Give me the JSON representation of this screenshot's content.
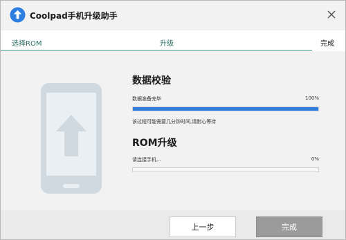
{
  "window": {
    "title": "Coolpad手机升级助手",
    "accent_color": "#2d7ee0"
  },
  "steps": [
    {
      "label": "选择ROM"
    },
    {
      "label": "升级"
    },
    {
      "label": "完成"
    }
  ],
  "sections": {
    "verify": {
      "title": "数据校验",
      "status": "数据准备完毕",
      "percent_text": "100%",
      "progress": 1.0,
      "note": "该过程可能需要几分钟时间,请耐心等待"
    },
    "upgrade": {
      "title": "ROM升级",
      "status": "请连接手机...",
      "percent_text": "0%",
      "progress": 0.0
    }
  },
  "footer": {
    "prev_label": "上一步",
    "finish_label": "完成"
  },
  "icons": {
    "app": "upload-arrow-icon",
    "close": "close-icon",
    "phone": "phone-upgrade-icon"
  }
}
